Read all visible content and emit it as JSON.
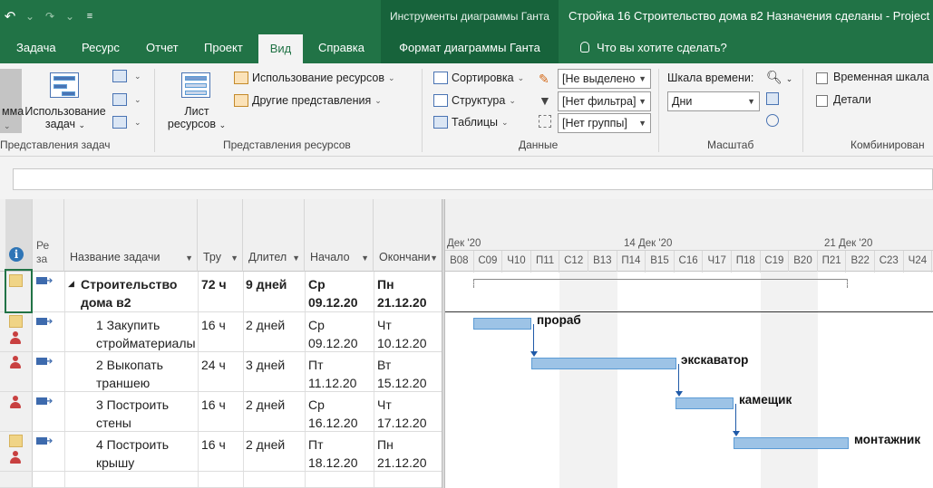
{
  "titlebar": {
    "undo_icon": "undo-icon",
    "redo_icon": "redo-icon",
    "tools_context": "Инструменты диаграммы Ганта",
    "document_title": "Стройка 16 Строительство дома в2 Назначения сделаны  -  Project"
  },
  "tabs": {
    "file": "Задача",
    "resource": "Ресурс",
    "report": "Отчет",
    "project": "Проект",
    "view": "Вид",
    "help": "Справка",
    "gantt_format": "Формат диаграммы Ганта",
    "tell_me": "Что вы хотите сделать?"
  },
  "ribbon": {
    "task_views": {
      "gantt_partial": "мма",
      "task_usage_line1": "Использование",
      "task_usage_line2": "задач",
      "label": "Представления задач"
    },
    "resource_views": {
      "sheet_line1": "Лист",
      "sheet_line2": "ресурсов",
      "resource_usage": "Использование ресурсов",
      "other_views": "Другие представления",
      "label": "Представления ресурсов"
    },
    "data": {
      "sort": "Сортировка",
      "outline": "Структура",
      "tables": "Таблицы",
      "highlight": "[Не выделено",
      "filter": "[Нет фильтра]",
      "group": "[Нет группы]",
      "label": "Данные"
    },
    "zoom": {
      "timescale_label": "Шкала времени:",
      "timescale_value": "Дни",
      "label": "Масштаб"
    },
    "split_view": {
      "timeline": "Временная шкала",
      "details": "Детали",
      "label": "Комбинирован"
    }
  },
  "table": {
    "columns": {
      "info": "i",
      "mode": "Ре за",
      "name": "Название задачи",
      "work": "Тру",
      "duration": "Длител",
      "start": "Начало",
      "finish": "Окончани"
    },
    "rows": [
      {
        "name1": "Строительство",
        "name2": "дома в2",
        "work": "72 ч",
        "duration": "9 дней",
        "start1": "Ср",
        "start2": "09.12.20",
        "finish1": "Пн",
        "finish2": "21.12.20"
      },
      {
        "name1": "1 Закупить",
        "name2": "стройматериалы",
        "work": "16 ч",
        "duration": "2 дней",
        "start1": "Ср",
        "start2": "09.12.20",
        "finish1": "Чт",
        "finish2": "10.12.20"
      },
      {
        "name1": "2 Выкопать",
        "name2": "траншею",
        "work": "24 ч",
        "duration": "3 дней",
        "start1": "Пт",
        "start2": "11.12.20",
        "finish1": "Вт",
        "finish2": "15.12.20"
      },
      {
        "name1": "3 Построить",
        "name2": "стены",
        "work": "16 ч",
        "duration": "2 дней",
        "start1": "Ср",
        "start2": "16.12.20",
        "finish1": "Чт",
        "finish2": "17.12.20"
      },
      {
        "name1": "4 Построить",
        "name2": "крышу",
        "work": "16 ч",
        "duration": "2 дней",
        "start1": "Пт",
        "start2": "18.12.20",
        "finish1": "Пн",
        "finish2": "21.12.20"
      }
    ]
  },
  "gantt": {
    "weeks": [
      "Дек '20",
      "14 Дек '20",
      "21 Дек '20"
    ],
    "days": [
      "В08",
      "С09",
      "Ч10",
      "П11",
      "С12",
      "В13",
      "П14",
      "В15",
      "С16",
      "Ч17",
      "П18",
      "С19",
      "В20",
      "П21",
      "В22",
      "С23",
      "Ч24"
    ],
    "resources": [
      "прораб",
      "экскаватор",
      "камещик",
      "монтажник"
    ],
    "colors": {
      "bar": "#9dc3e6",
      "bar_border": "#5b9bd5",
      "link": "#1f5aa8",
      "accent": "#217346"
    }
  }
}
